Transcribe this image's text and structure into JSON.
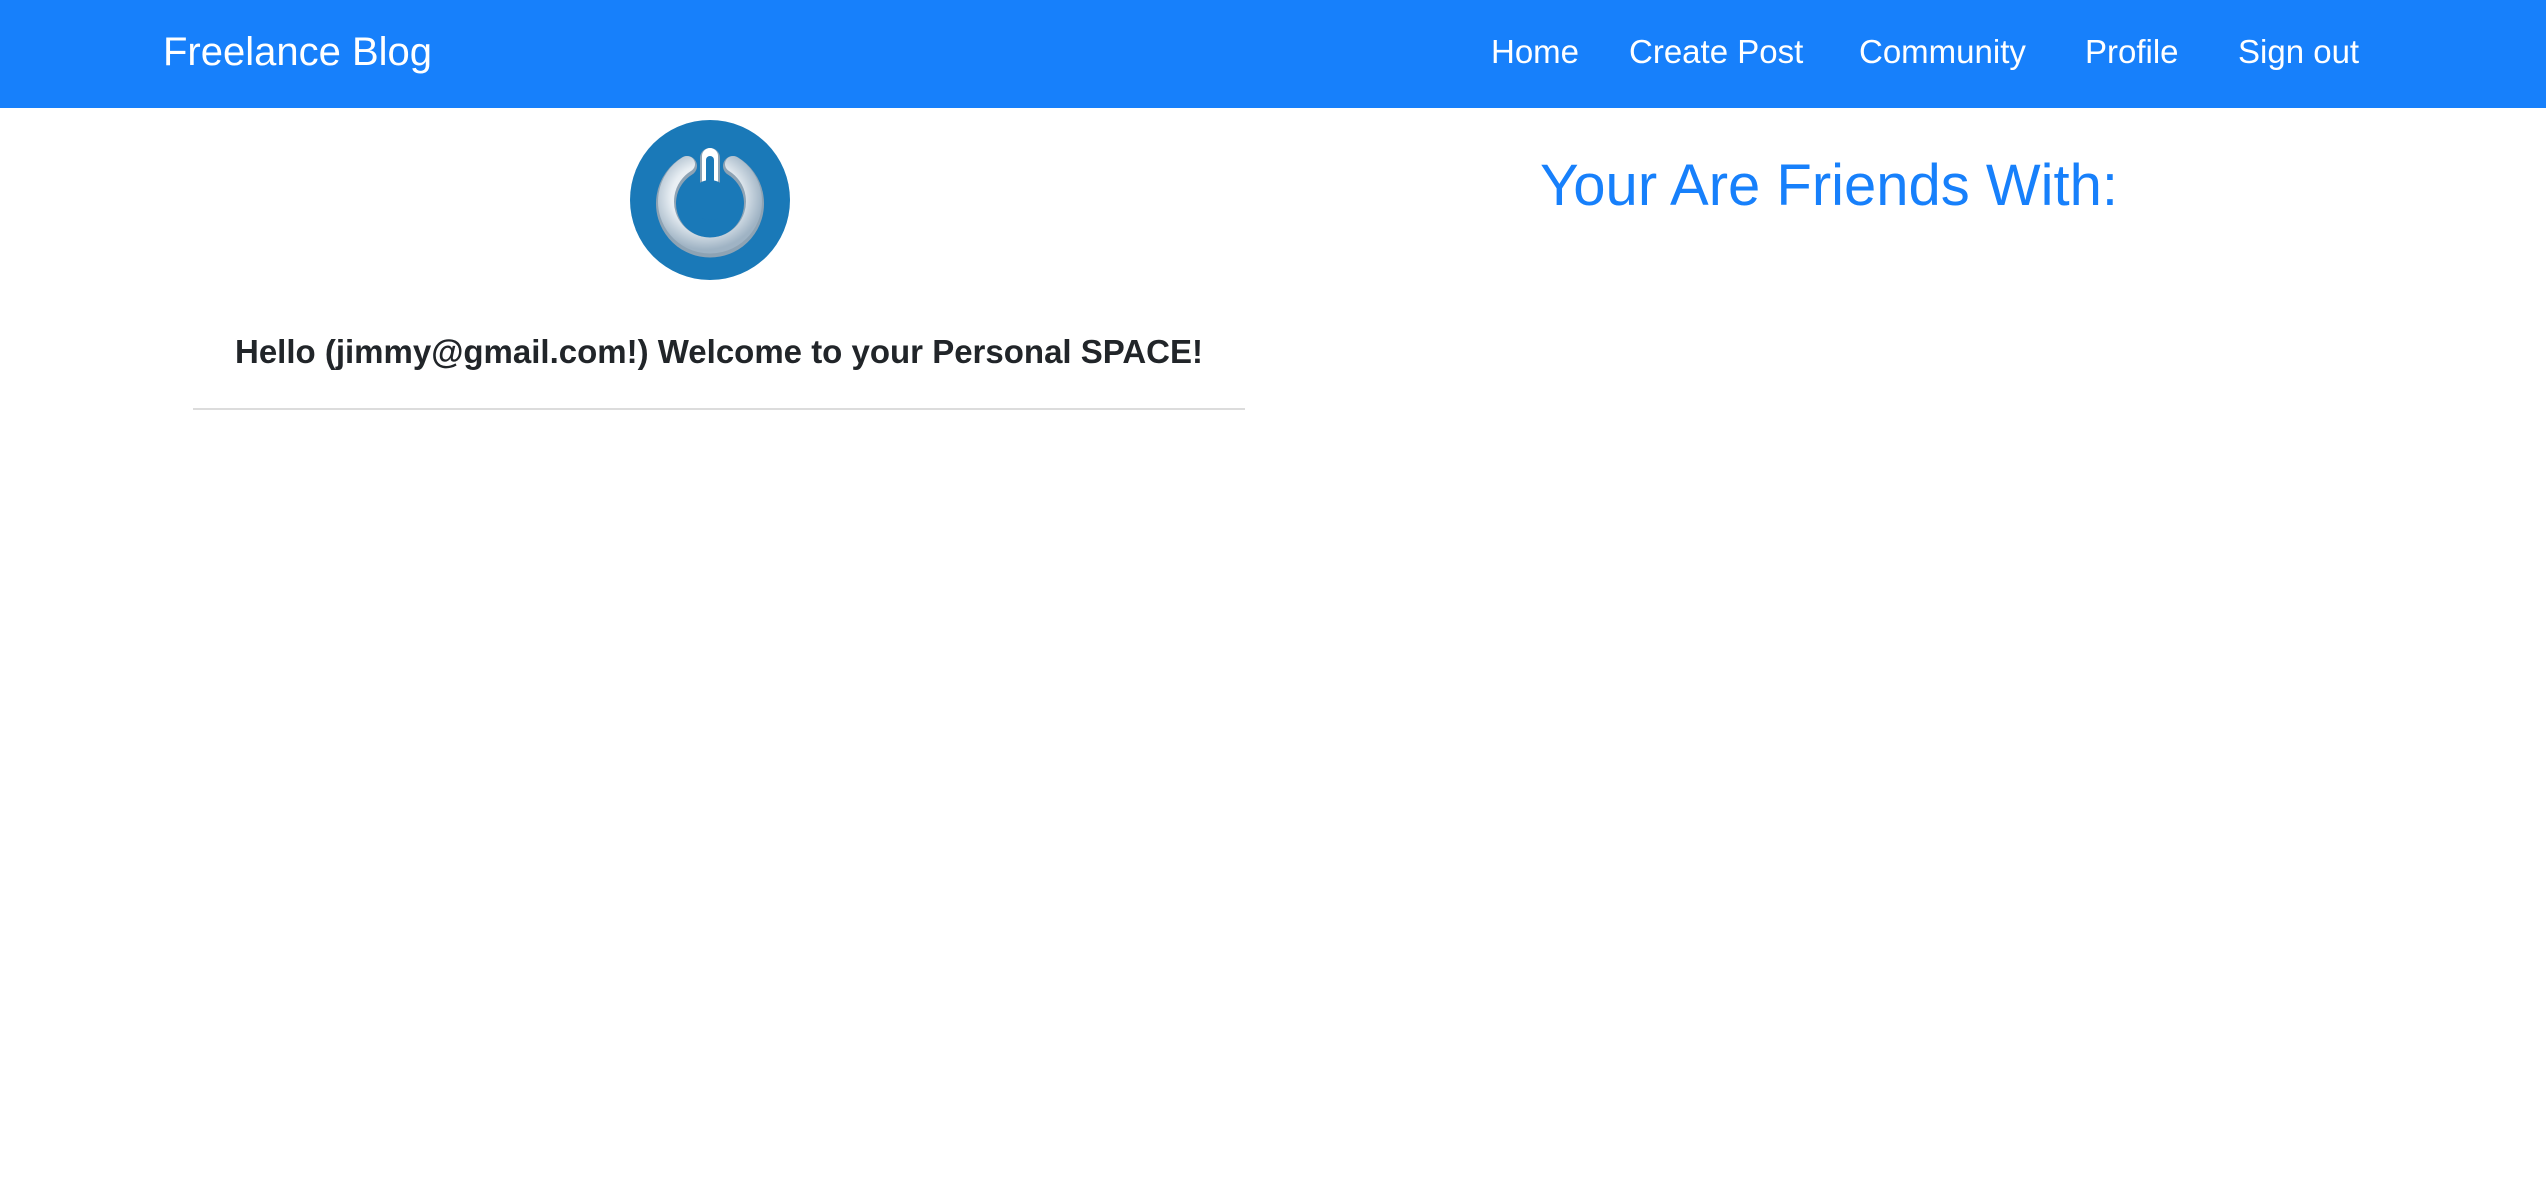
{
  "navbar": {
    "brand": "Freelance Blog",
    "links": [
      {
        "label": "Home"
      },
      {
        "label": "Create Post"
      },
      {
        "label": "Community"
      },
      {
        "label": "Profile"
      },
      {
        "label": "Sign out"
      }
    ],
    "background_color": "#1780fb"
  },
  "profile": {
    "avatar_icon": "power-button-icon",
    "welcome_text": "Hello (jimmy@gmail.com!) Welcome to your Personal SPACE!"
  },
  "friends": {
    "heading": "Your Are Friends With:",
    "heading_color": "#1780fb"
  }
}
